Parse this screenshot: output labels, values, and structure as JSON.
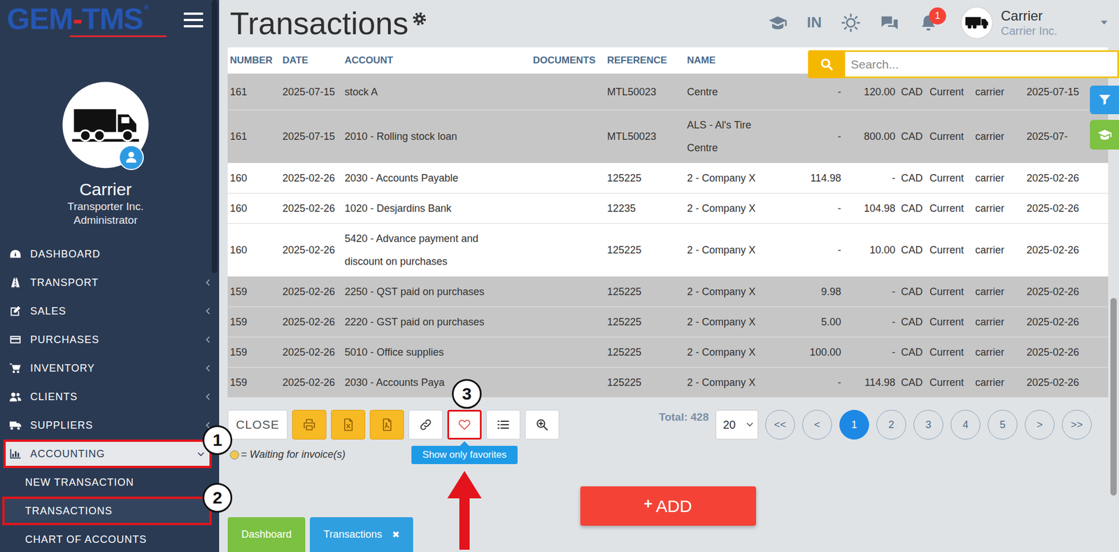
{
  "logo": {
    "left": "GEM",
    "dash": "-",
    "right": "TMS",
    "mark": "®"
  },
  "profile": {
    "name": "Carrier",
    "company": "Transporter Inc.",
    "role": "Administrator"
  },
  "sidebar": {
    "items": [
      {
        "label": "DASHBOARD",
        "has_children": false,
        "expanded": false,
        "selected": false,
        "marked": false,
        "children": []
      },
      {
        "label": "TRANSPORT",
        "has_children": true,
        "expanded": false,
        "selected": false,
        "marked": false,
        "children": []
      },
      {
        "label": "SALES",
        "has_children": true,
        "expanded": false,
        "selected": false,
        "marked": false,
        "children": []
      },
      {
        "label": "PURCHASES",
        "has_children": true,
        "expanded": false,
        "selected": false,
        "marked": false,
        "children": []
      },
      {
        "label": "INVENTORY",
        "has_children": true,
        "expanded": false,
        "selected": false,
        "marked": false,
        "children": []
      },
      {
        "label": "CLIENTS",
        "has_children": true,
        "expanded": false,
        "selected": false,
        "marked": false,
        "children": []
      },
      {
        "label": "SUPPLIERS",
        "has_children": true,
        "expanded": false,
        "selected": false,
        "marked": false,
        "children": []
      },
      {
        "label": "ACCOUNTING",
        "has_children": true,
        "expanded": true,
        "selected": true,
        "marked": true,
        "children": [
          {
            "label": "NEW TRANSACTION",
            "selected": false,
            "marked": false
          },
          {
            "label": "TRANSACTIONS",
            "selected": true,
            "marked": true
          },
          {
            "label": "CHART OF ACCOUNTS",
            "selected": false,
            "marked": false
          }
        ]
      }
    ]
  },
  "annotations": [
    "1",
    "2",
    "3"
  ],
  "header": {
    "title": "Transactions",
    "language": "IN",
    "notifications": "1",
    "user_name": "Carrier",
    "user_company": "Carrier Inc."
  },
  "search": {
    "placeholder": "Search..."
  },
  "table": {
    "columns": [
      "NUMBER",
      "DATE",
      "ACCOUNT",
      "DOCUMENTS",
      "REFERENCE",
      "NAME"
    ],
    "rows": [
      {
        "number": "161",
        "date": "2025-07-15",
        "account": "stock A",
        "reference": "MTL50023",
        "name": "Centre",
        "debit": "-",
        "credit": "120.00",
        "currency": "CAD",
        "status": "Current",
        "user": "carrier",
        "date2": "2025-07-15",
        "shaded": true
      },
      {
        "number": "161",
        "date": "2025-07-15",
        "account": "2010 - Rolling stock loan",
        "reference": "MTL50023",
        "name": "ALS - Al's Tire Centre",
        "debit": "-",
        "credit": "800.00",
        "currency": "CAD",
        "status": "Current",
        "user": "carrier",
        "date2": "2025-07-",
        "shaded": true
      },
      {
        "number": "160",
        "date": "2025-02-26",
        "account": "2030 - Accounts Payable",
        "reference": "125225",
        "name": "2 - Company X",
        "debit": "114.98",
        "credit": "-",
        "currency": "CAD",
        "status": "Current",
        "user": "carrier",
        "date2": "2025-02-26",
        "shaded": false
      },
      {
        "number": "160",
        "date": "2025-02-26",
        "account": "1020 - Desjardins Bank",
        "reference": "12235",
        "name": "2 - Company X",
        "debit": "-",
        "credit": "104.98",
        "currency": "CAD",
        "status": "Current",
        "user": "carrier",
        "date2": "2025-02-26",
        "shaded": false
      },
      {
        "number": "160",
        "date": "2025-02-26",
        "account": "5420 - Advance payment and discount on purchases",
        "reference": "125225",
        "name": "2 - Company X",
        "debit": "-",
        "credit": "10.00",
        "currency": "CAD",
        "status": "Current",
        "user": "carrier",
        "date2": "2025-02-26",
        "shaded": false
      },
      {
        "number": "159",
        "date": "2025-02-26",
        "account": "2250 - QST paid on purchases",
        "reference": "125225",
        "name": "2 - Company X",
        "debit": "9.98",
        "credit": "-",
        "currency": "CAD",
        "status": "Current",
        "user": "carrier",
        "date2": "2025-02-26",
        "shaded": true
      },
      {
        "number": "159",
        "date": "2025-02-26",
        "account": "2220 - GST paid on purchases",
        "reference": "125225",
        "name": "2 - Company X",
        "debit": "5.00",
        "credit": "-",
        "currency": "CAD",
        "status": "Current",
        "user": "carrier",
        "date2": "2025-02-26",
        "shaded": true
      },
      {
        "number": "159",
        "date": "2025-02-26",
        "account": "5010 - Office supplies",
        "reference": "125225",
        "name": "2 - Company X",
        "debit": "100.00",
        "credit": "-",
        "currency": "CAD",
        "status": "Current",
        "user": "carrier",
        "date2": "2025-02-26",
        "shaded": true
      },
      {
        "number": "159",
        "date": "2025-02-26",
        "account": "2030 - Accounts Paya",
        "reference": "125225",
        "name": "2 - Company X",
        "debit": "-",
        "credit": "114.98",
        "currency": "CAD",
        "status": "Current",
        "user": "carrier",
        "date2": "2025-02-26",
        "shaded": true
      }
    ]
  },
  "toolbar": {
    "close": "CLOSE",
    "favorites": {
      "marked": true,
      "tooltip": "Show only favorites"
    }
  },
  "legend": {
    "text": "= Waiting for invoice(s)"
  },
  "pagination": {
    "total": "Total: 428",
    "page_size": "20",
    "pages": [
      {
        "label": "<<",
        "selected": false
      },
      {
        "label": "<",
        "selected": false
      },
      {
        "label": "1",
        "selected": true
      },
      {
        "label": "2",
        "selected": false
      },
      {
        "label": "3",
        "selected": false
      },
      {
        "label": "4",
        "selected": false
      },
      {
        "label": "5",
        "selected": false
      },
      {
        "label": ">",
        "selected": false
      },
      {
        "label": ">>",
        "selected": false
      }
    ]
  },
  "add_button": {
    "plus": "+",
    "label": "ADD"
  },
  "bottom_tabs": [
    {
      "label": "Dashboard",
      "selected": false,
      "closable": false,
      "color": "#7cc142"
    },
    {
      "label": "Transactions",
      "selected": true,
      "closable": true,
      "color": "#2f9fe0"
    }
  ],
  "tab_close": "✖"
}
